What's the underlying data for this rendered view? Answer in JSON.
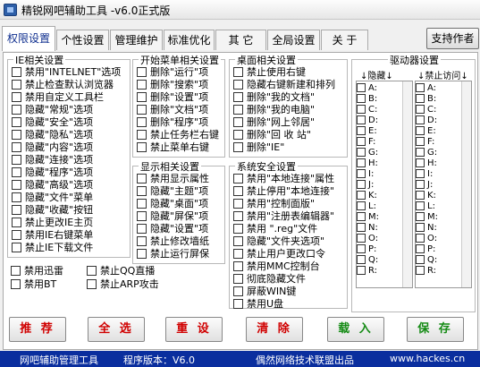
{
  "window": {
    "title": "精锐网吧辅助工具 -v6.0正式版"
  },
  "tabs": [
    "权限设置",
    "个性设置",
    "管理维护",
    "标准优化",
    "其 它",
    "全局设置",
    "关 于"
  ],
  "author_button": "支持作者",
  "ie_group": {
    "title": "IE相关设置",
    "items": [
      "禁用\"INTELNET\"选项",
      "禁止检查默认浏览器",
      "禁用自定义工具栏",
      "隐藏\"常规\"选项",
      "隐藏\"安全\"选项",
      "隐藏\"隐私\"选项",
      "隐藏\"内容\"选项",
      "隐藏\"连接\"选项",
      "隐藏\"程序\"选项",
      "隐藏\"高级\"选项",
      "隐藏\"文件\"菜单",
      "隐藏\"收藏\"按钮",
      "禁止更改IE主页",
      "禁用IE右键菜单",
      "禁止IE下载文件"
    ]
  },
  "misc_items": [
    "禁用迅雷",
    "禁用BT",
    "禁止QQ直播",
    "禁止ARP攻击"
  ],
  "start_menu_group": {
    "title": "开始菜单相关设置",
    "items": [
      "删除\"运行\"项",
      "删除\"搜索\"项",
      "删除\"设置\"项",
      "删除\"文档\"项",
      "删除\"程序\"项",
      "禁止任务栏右键",
      "禁止菜单右键"
    ]
  },
  "display_group": {
    "title": "显示相关设置",
    "items": [
      "禁用显示属性",
      "隐藏\"主题\"项",
      "隐藏\"桌面\"项",
      "隐藏\"屏保\"项",
      "隐藏\"设置\"项",
      "禁止修改墙纸",
      "禁止运行屏保"
    ]
  },
  "desktop_group": {
    "title": "桌面相关设置",
    "items": [
      "禁止使用右键",
      "隐藏右键新建和排列",
      "删除\"我的文档\"",
      "删除\"我的电脑\"",
      "删除\"网上邻居\"",
      "删除\"回 收 站\"",
      "删除\"IE\""
    ]
  },
  "system_group": {
    "title": "系统安全设置",
    "items": [
      "禁用\"本地连接\"属性",
      "禁止停用\"本地连接\"",
      "禁用\"控制面版\"",
      "禁用\"注册表编辑器\"",
      "禁用 \".reg\"文件",
      "隐藏\"文件夹选项\"",
      "禁止用户更改口令",
      "禁用MMC控制台",
      "彻底隐藏文件",
      "屏蔽WIN键",
      "禁用U盘"
    ]
  },
  "drive_group": {
    "title": "驱动器设置",
    "hide_header": "↓隐藏↓",
    "block_header": "↓禁止访问↓",
    "drives": [
      "A:",
      "B:",
      "C:",
      "D:",
      "E:",
      "F:",
      "G:",
      "H:",
      "I:",
      "J:",
      "K:",
      "L:",
      "M:",
      "N:",
      "O:",
      "P:",
      "Q:",
      "R:"
    ]
  },
  "actions": [
    "推 荐",
    "全 选",
    "重 设",
    "清 除",
    "载 入",
    "保 存"
  ],
  "statusbar": {
    "left": "网吧辅助管理工具",
    "version_label": "程序版本：V6.0",
    "company": "偶然网络技术联盟出品",
    "url": "www.hackes.cn"
  }
}
